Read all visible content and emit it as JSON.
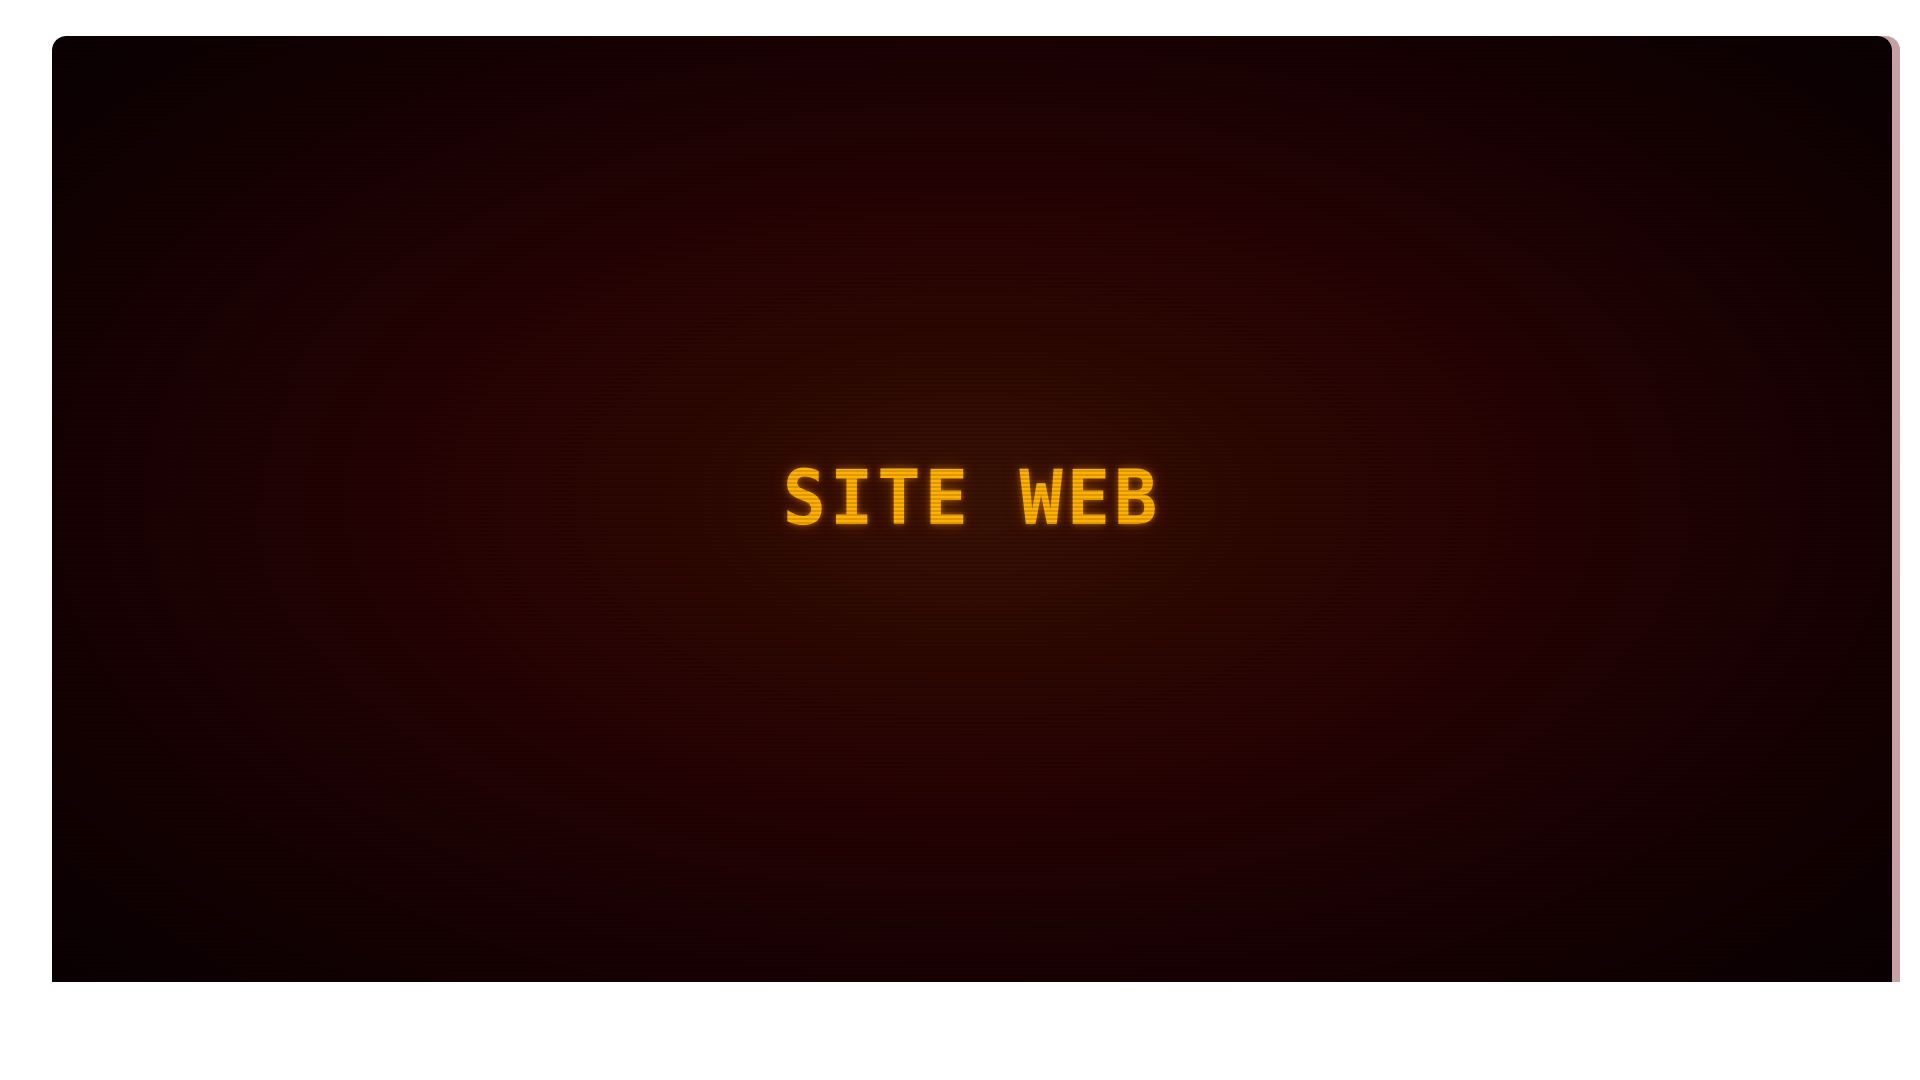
{
  "screen": {
    "title": "SITE WEB",
    "text_color": "#ffb000",
    "background_center_color": "#3a1204",
    "background_edge_color": "#0c0002",
    "edge_accent_color": "#c7a0a3"
  }
}
